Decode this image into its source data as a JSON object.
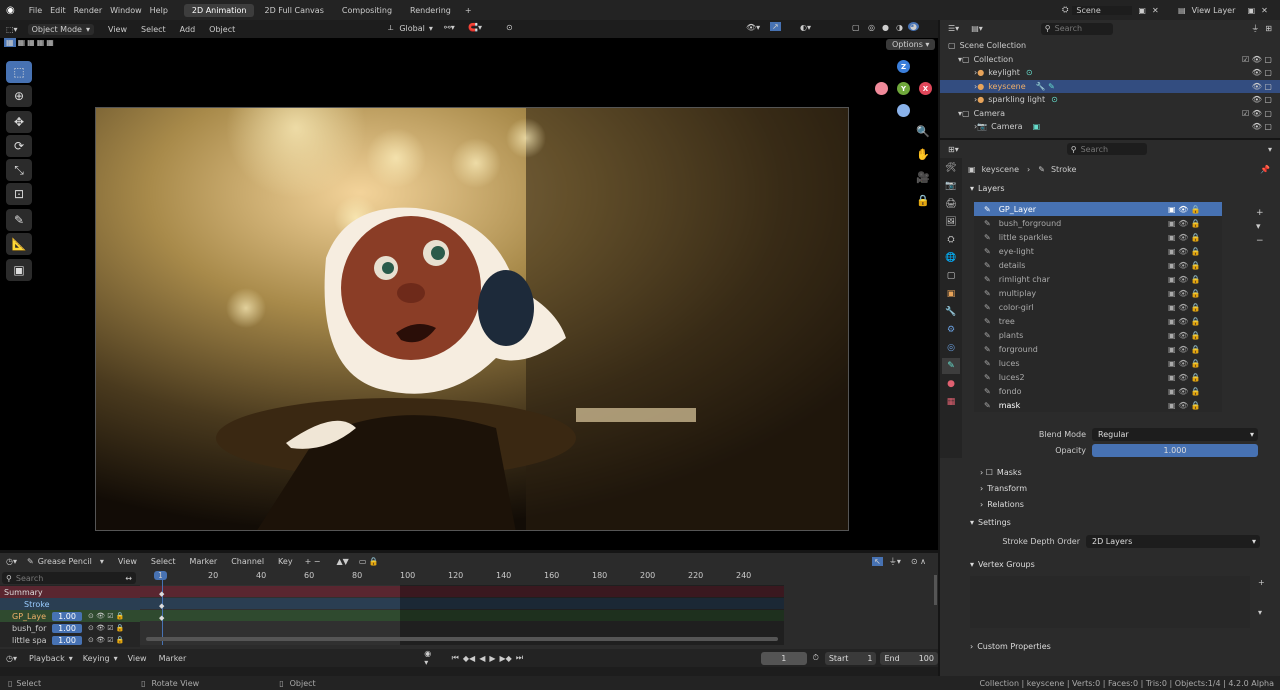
{
  "menu": [
    "File",
    "Edit",
    "Render",
    "Window",
    "Help"
  ],
  "workspaces": [
    "2D Animation",
    "2D Full Canvas",
    "Compositing",
    "Rendering"
  ],
  "scene": "Scene",
  "view_layer": "View Layer",
  "vp": {
    "mode": "Object Mode",
    "menus": [
      "View",
      "Select",
      "Add",
      "Object"
    ],
    "orientation": "Global",
    "options": "Options"
  },
  "outliner": {
    "search": "Search",
    "items": [
      "Scene Collection",
      "Collection",
      "keylight",
      "keyscene",
      "sparkling light",
      "Camera",
      "Camera"
    ]
  },
  "props": {
    "search": "Search",
    "object": "keyscene",
    "data": "Stroke",
    "layers_title": "Layers",
    "layers": [
      "GP_Layer",
      "bush_forground",
      "little sparkles",
      "eye-light",
      "details",
      "rimlight char",
      "multiplay",
      "color-girl",
      "tree",
      "plants",
      "forground",
      "luces",
      "luces2",
      "fondo",
      "mask"
    ],
    "blend_label": "Blend Mode",
    "blend": "Regular",
    "opacity_label": "Opacity",
    "opacity": "1.000",
    "masks": "Masks",
    "transform": "Transform",
    "relations": "Relations",
    "settings": "Settings",
    "sdo_label": "Stroke Depth Order",
    "sdo": "2D Layers",
    "vgroups": "Vertex Groups",
    "custom": "Custom Properties"
  },
  "timeline": {
    "mode": "Grease Pencil",
    "menus": [
      "View",
      "Select",
      "Marker",
      "Channel",
      "Key"
    ],
    "search": "Search",
    "ticks": [
      "1",
      "20",
      "40",
      "60",
      "80",
      "100",
      "120",
      "140",
      "160",
      "180",
      "200",
      "220",
      "240"
    ],
    "summary": "Summary",
    "stroke": "Stroke",
    "rows": [
      {
        "name": "GP_Laye",
        "val": "1.00"
      },
      {
        "name": "bush_for",
        "val": "1.00"
      },
      {
        "name": "little spa",
        "val": "1.00"
      }
    ]
  },
  "playback": {
    "menus": [
      "Playback",
      "Keying",
      "View",
      "Marker"
    ],
    "frame": "1",
    "start_label": "Start",
    "start": "1",
    "end_label": "End",
    "end": "100"
  },
  "status": {
    "select": "Select",
    "rotate": "Rotate View",
    "object": "Object",
    "info": "Collection | keyscene | Verts:0 | Faces:0 | Tris:0 | Objects:1/4 | 4.2.0 Alpha"
  },
  "gizmo": {
    "z": "Z",
    "y": "Y",
    "x": "X"
  },
  "colors": {
    "accent": "#4772b3",
    "bg": "#1d1d1d",
    "panel": "#2b2b2b"
  }
}
